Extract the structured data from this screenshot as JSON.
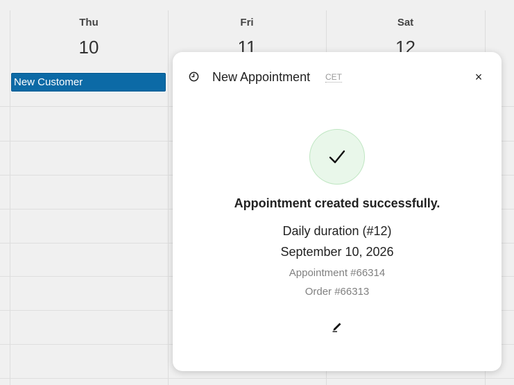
{
  "calendar": {
    "days": [
      {
        "name": "Thu",
        "number": "10"
      },
      {
        "name": "Fri",
        "number": "11"
      },
      {
        "name": "Sat",
        "number": "12"
      }
    ],
    "event": {
      "title": "New Customer",
      "color": "#0c6aa6"
    }
  },
  "popup": {
    "title": "New Appointment",
    "timezone": "CET",
    "close_label": "×",
    "icons": {
      "header": "clock-icon",
      "status": "check-icon",
      "edit": "pencil-icon",
      "close": "close-icon"
    },
    "success_message": "Appointment created successfully.",
    "service": "Daily duration (#12)",
    "date": "September 10, 2026",
    "appointment": "Appointment #66314",
    "order": "Order #66313",
    "success_color": "#e9f7ea"
  }
}
